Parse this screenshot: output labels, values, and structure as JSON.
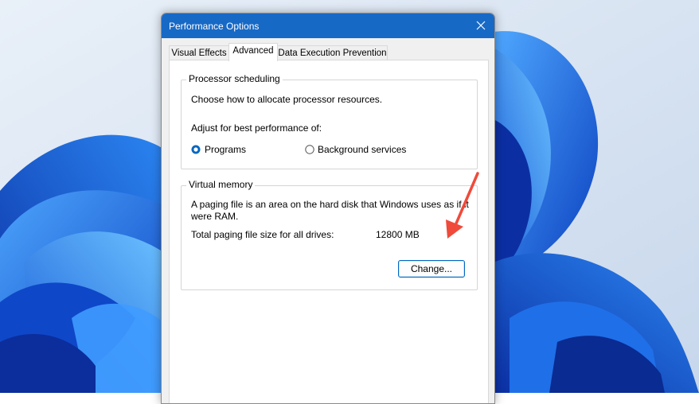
{
  "window": {
    "title": "Performance Options",
    "close_glyph": "✕",
    "accent_color": "#1769c6"
  },
  "tabs": [
    {
      "label": "Visual Effects",
      "active": false
    },
    {
      "label": "Advanced",
      "active": true
    },
    {
      "label": "Data Execution Prevention",
      "active": false
    }
  ],
  "processor": {
    "legend": "Processor scheduling",
    "description": "Choose how to allocate processor resources.",
    "adjust_label": "Adjust for best performance of:",
    "options": [
      {
        "label": "Programs",
        "selected": true
      },
      {
        "label": "Background services",
        "selected": false
      }
    ]
  },
  "virtual_memory": {
    "legend": "Virtual memory",
    "description_line1": "A paging file is an area on the hard disk that Windows uses as if it",
    "description_line2": "were RAM.",
    "total_label": "Total paging file size for all drives:",
    "total_value": "12800 MB",
    "change_button": "Change..."
  },
  "annotation": {
    "arrow_color": "#f04a3a"
  },
  "icons": {
    "close": "close-icon",
    "arrow": "red-arrow-icon"
  }
}
